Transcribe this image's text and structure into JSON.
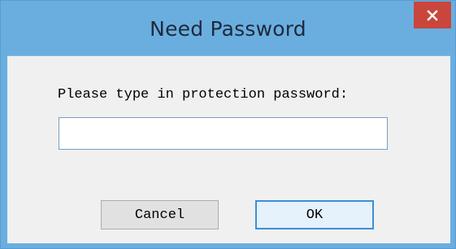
{
  "window": {
    "title": "Need Password",
    "close_symbol": "✕",
    "colors": {
      "frame": "#6aaee0",
      "close_button": "#c9463d",
      "client_background": "#f0f0f0"
    }
  },
  "dialog": {
    "prompt": "Please type in protection password:",
    "password": {
      "value": "",
      "placeholder": ""
    },
    "buttons": {
      "cancel_label": "Cancel",
      "ok_label": "OK"
    }
  },
  "icons": {
    "close": "close-icon"
  }
}
